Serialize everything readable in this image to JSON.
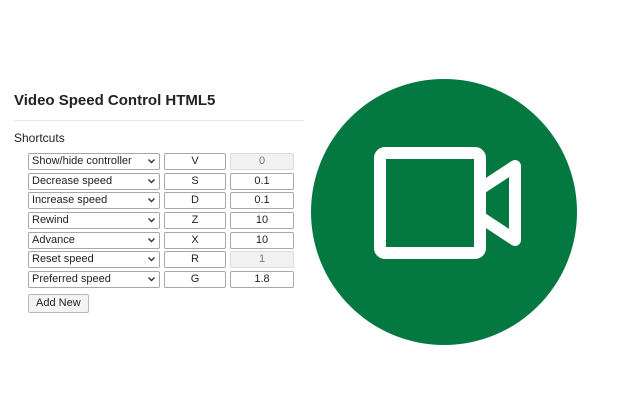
{
  "app": {
    "title": "Video Speed Control HTML5",
    "section": "Shortcuts",
    "add_button": "Add New"
  },
  "shortcuts": [
    {
      "action": "Show/hide controller",
      "key": "V",
      "value": "0",
      "value_disabled": true
    },
    {
      "action": "Decrease speed",
      "key": "S",
      "value": "0.1",
      "value_disabled": false
    },
    {
      "action": "Increase speed",
      "key": "D",
      "value": "0.1",
      "value_disabled": false
    },
    {
      "action": "Rewind",
      "key": "Z",
      "value": "10",
      "value_disabled": false
    },
    {
      "action": "Advance",
      "key": "X",
      "value": "10",
      "value_disabled": false
    },
    {
      "action": "Reset speed",
      "key": "R",
      "value": "1",
      "value_disabled": true
    },
    {
      "action": "Preferred speed",
      "key": "G",
      "value": "1.8",
      "value_disabled": false
    }
  ],
  "logo": {
    "icon": "video-camera-icon",
    "background_color": "#037841",
    "foreground_color": "#ffffff"
  }
}
